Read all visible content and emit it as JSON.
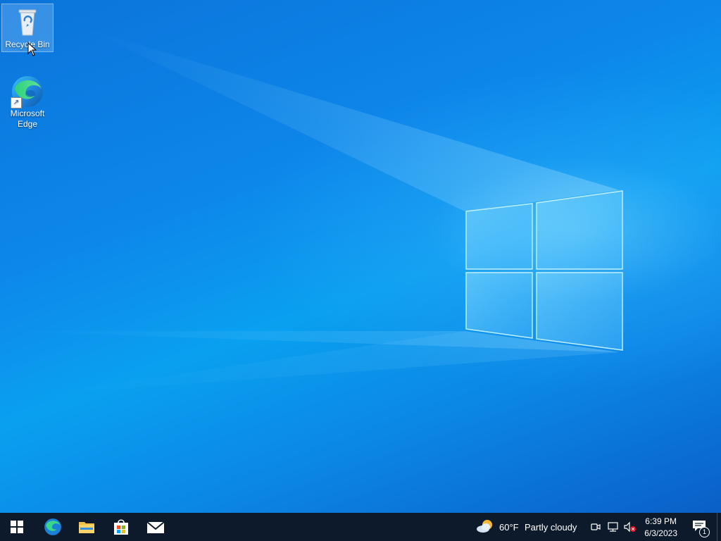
{
  "desktop": {
    "icons": [
      {
        "label": "Recycle Bin"
      },
      {
        "label_line1": "Microsoft",
        "label_line2": "Edge"
      }
    ]
  },
  "taskbar": {
    "apps": [
      "start-icon",
      "edge-icon",
      "file-explorer-icon",
      "store-icon",
      "mail-icon"
    ],
    "weather": {
      "temp": "60°F",
      "condition": "Partly cloudy"
    },
    "clock": {
      "time": "6:39 PM",
      "date": "6/3/2023"
    },
    "notifications": {
      "count": "1"
    }
  }
}
